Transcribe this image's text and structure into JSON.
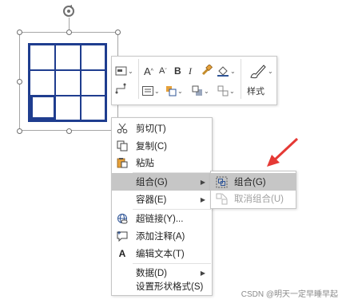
{
  "mini_toolbar": {
    "style_label": "样式",
    "bold_glyph": "B",
    "italic_glyph": "I",
    "grow_font_glyph": "A",
    "shrink_font_glyph": "A"
  },
  "context_menu": {
    "items": [
      {
        "label": "剪切(T)",
        "icon": "scissors-icon"
      },
      {
        "label": "复制(C)",
        "icon": "copy-icon"
      },
      {
        "label": "粘贴",
        "icon": "paste-icon"
      },
      {
        "label": "组合(G)",
        "icon": "",
        "has_submenu": true,
        "highlighted": true
      },
      {
        "label": "容器(E)",
        "icon": "",
        "has_submenu": true
      },
      {
        "label": "超链接(Y)...",
        "icon": "hyperlink-icon"
      },
      {
        "label": "添加注释(A)",
        "icon": "comment-icon"
      },
      {
        "label": "编辑文本(T)",
        "icon": "text-icon",
        "icon_glyph": "A"
      },
      {
        "label": "数据(D)",
        "icon": "",
        "has_submenu": true
      },
      {
        "label": "设置形状格式(S)",
        "icon": ""
      }
    ]
  },
  "submenu": {
    "items": [
      {
        "label": "组合(G)",
        "icon": "group-icon",
        "highlighted": true
      },
      {
        "label": "取消组合(U)",
        "icon": "ungroup-icon",
        "disabled": true
      }
    ]
  },
  "watermark": "CSDN @明天一定早睡早起",
  "colors": {
    "grid": "#1f3d8f",
    "arrow": "#e53935",
    "highlight": "#c6c6c6",
    "disabled_text": "#a0a0a0"
  }
}
